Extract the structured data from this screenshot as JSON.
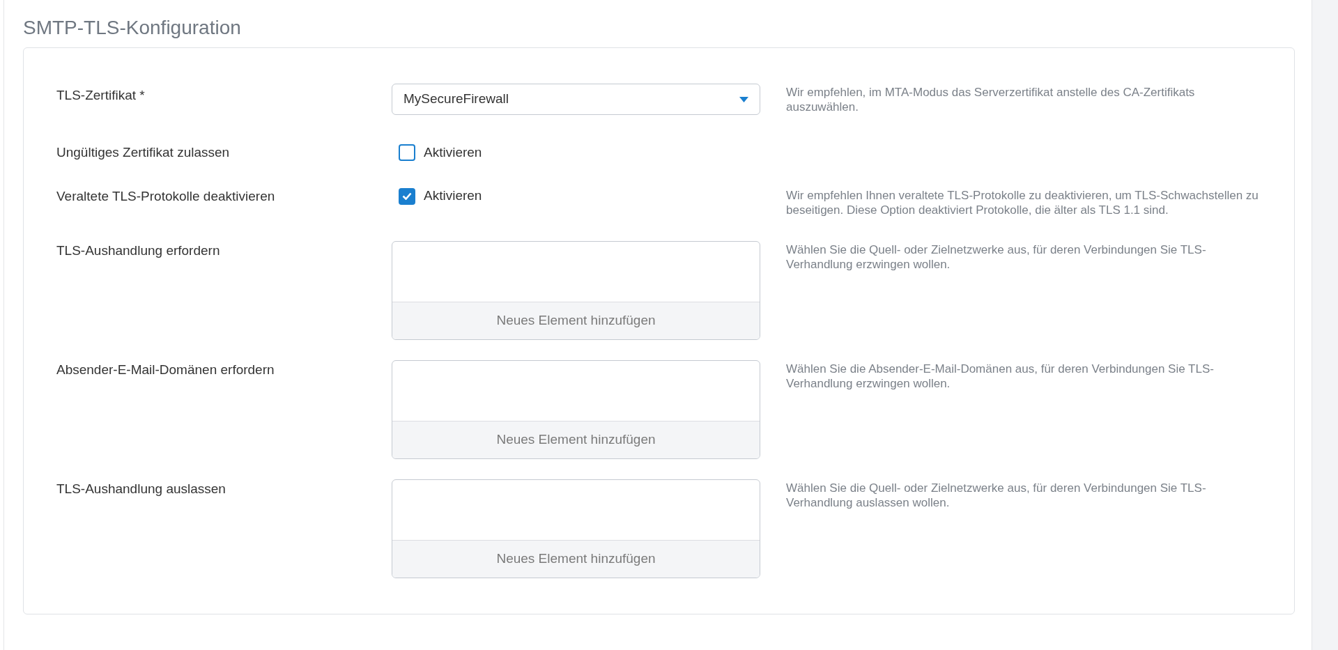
{
  "section_title": "SMTP-TLS-Konfiguration",
  "fields": [
    {
      "kind": "select",
      "label": "TLS-Zertifikat *",
      "value": "MySecureFirewall",
      "help": "Wir empfehlen, im MTA-Modus das Serverzertifikat anstelle des CA-Zertifikats auszuwählen."
    },
    {
      "kind": "checkbox",
      "label": "Ungültiges Zertifikat zulassen",
      "option": "Aktivieren",
      "checked": false
    },
    {
      "kind": "checkbox",
      "label": "Veraltete TLS-Protokolle deaktivieren",
      "option": "Aktivieren",
      "checked": true,
      "help": "Wir empfehlen Ihnen veraltete TLS-Protokolle zu deaktivieren, um TLS-Schwachstellen zu beseitigen. Diese Option deaktiviert Protokolle, die älter als TLS 1.1 sind."
    },
    {
      "kind": "list",
      "label": "TLS-Aushandlung erfordern",
      "add_label": "Neues Element hinzufügen",
      "help": "Wählen Sie die Quell- oder Zielnetzwerke aus, für deren Verbindungen Sie TLS-Verhandlung erzwingen wollen."
    },
    {
      "kind": "list",
      "label": "Absender-E-Mail-Domänen erfordern",
      "add_label": "Neues Element hinzufügen",
      "help": "Wählen Sie die Absender-E-Mail-Domänen aus, für deren Verbindungen Sie TLS-Verhandlung erzwingen wollen."
    },
    {
      "kind": "list",
      "label": "TLS-Aushandlung auslassen",
      "add_label": "Neues Element hinzufügen",
      "help": "Wählen Sie die Quell- oder Zielnetzwerke aus, für deren Verbindungen Sie TLS-Verhandlung auslassen wollen."
    }
  ]
}
